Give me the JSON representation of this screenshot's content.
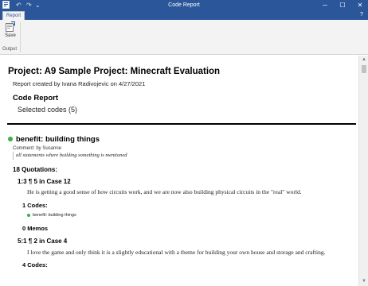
{
  "window": {
    "title": "Code Report",
    "minimize_glyph": "─",
    "maximize_glyph": "☐",
    "close_glyph": "✕",
    "help_glyph": "?",
    "qat_undo_glyph": "↶",
    "qat_redo_glyph": "↷",
    "qat_menu_glyph": "⌄"
  },
  "ribbon": {
    "tab_label": "Report",
    "save_label": "Save",
    "group_label": "Output"
  },
  "report": {
    "project_title": "Project: A9 Sample Project: Minecraft Evaluation",
    "created_by": "Report created by Ivana Radivojevic on 4/27/2021",
    "section_title": "Code Report",
    "selected_codes": "Selected codes (5)",
    "code": {
      "name": "benefit: building things",
      "color": "#3cb043",
      "comment_label": "Comment: by Susanne",
      "comment_text": "all statements where building something is mentioned",
      "quotation_count": "18 Quotations:"
    },
    "quotations": [
      {
        "header": "1:3 ¶ 5 in Case 12",
        "text": "He is getting a good sense of how circuits work, and we are now also building physical circuits in the \"real\" world.",
        "codes_label": "1 Codes:",
        "codes": [
          "benefit: building things"
        ],
        "memos_label": "0 Memos"
      },
      {
        "header": "5:1 ¶ 2 in Case 4",
        "text": "I love the game and only think it is a slightly educational with a theme for building your own house and storage and crafting.",
        "codes_label": "4 Codes:"
      }
    ]
  }
}
